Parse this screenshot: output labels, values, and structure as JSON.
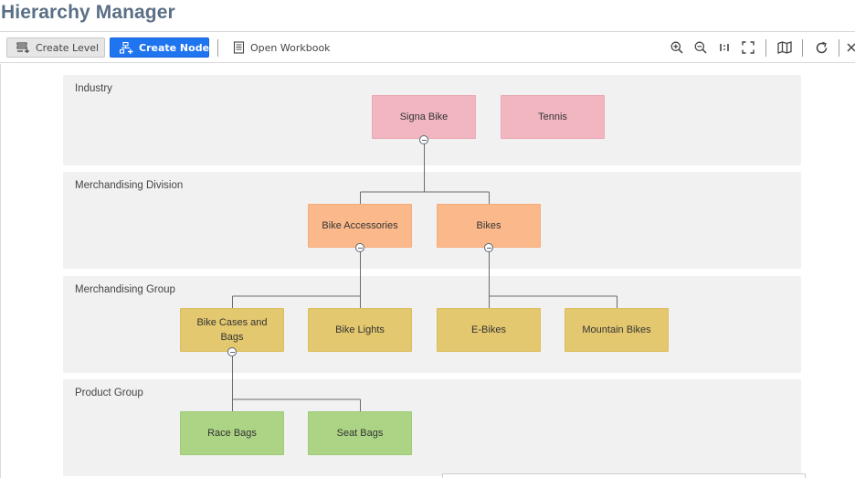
{
  "app": {
    "title": "Hierarchy Manager"
  },
  "toolbar": {
    "create_level": "Create Level",
    "create_node": "Create Node",
    "open_workbook": "Open Workbook",
    "icons": [
      "zoom-in-icon",
      "zoom-out-icon",
      "actual-size-icon",
      "fit-screen-icon",
      "map-icon",
      "refresh-icon",
      "close-icon"
    ],
    "accent": "#1f74f0"
  },
  "levels": [
    {
      "label": "Industry",
      "color": "#f1b6c0"
    },
    {
      "label": "Merchandising Division",
      "color": "#fbb98b"
    },
    {
      "label": "Merchandising Group",
      "color": "#e4c86f"
    },
    {
      "label": "Product Group",
      "color": "#acd485"
    }
  ],
  "nodes": {
    "signa_bike": "Signa Bike",
    "tennis": "Tennis",
    "bike_accessories": "Bike Accessories",
    "bikes": "Bikes",
    "bike_cases_and_bags": "Bike Cases and Bags",
    "bike_lights": "Bike Lights",
    "e_bikes": "E-Bikes",
    "mountain_bikes": "Mountain Bikes",
    "race_bags": "Race Bags",
    "seat_bags": "Seat Bags"
  }
}
